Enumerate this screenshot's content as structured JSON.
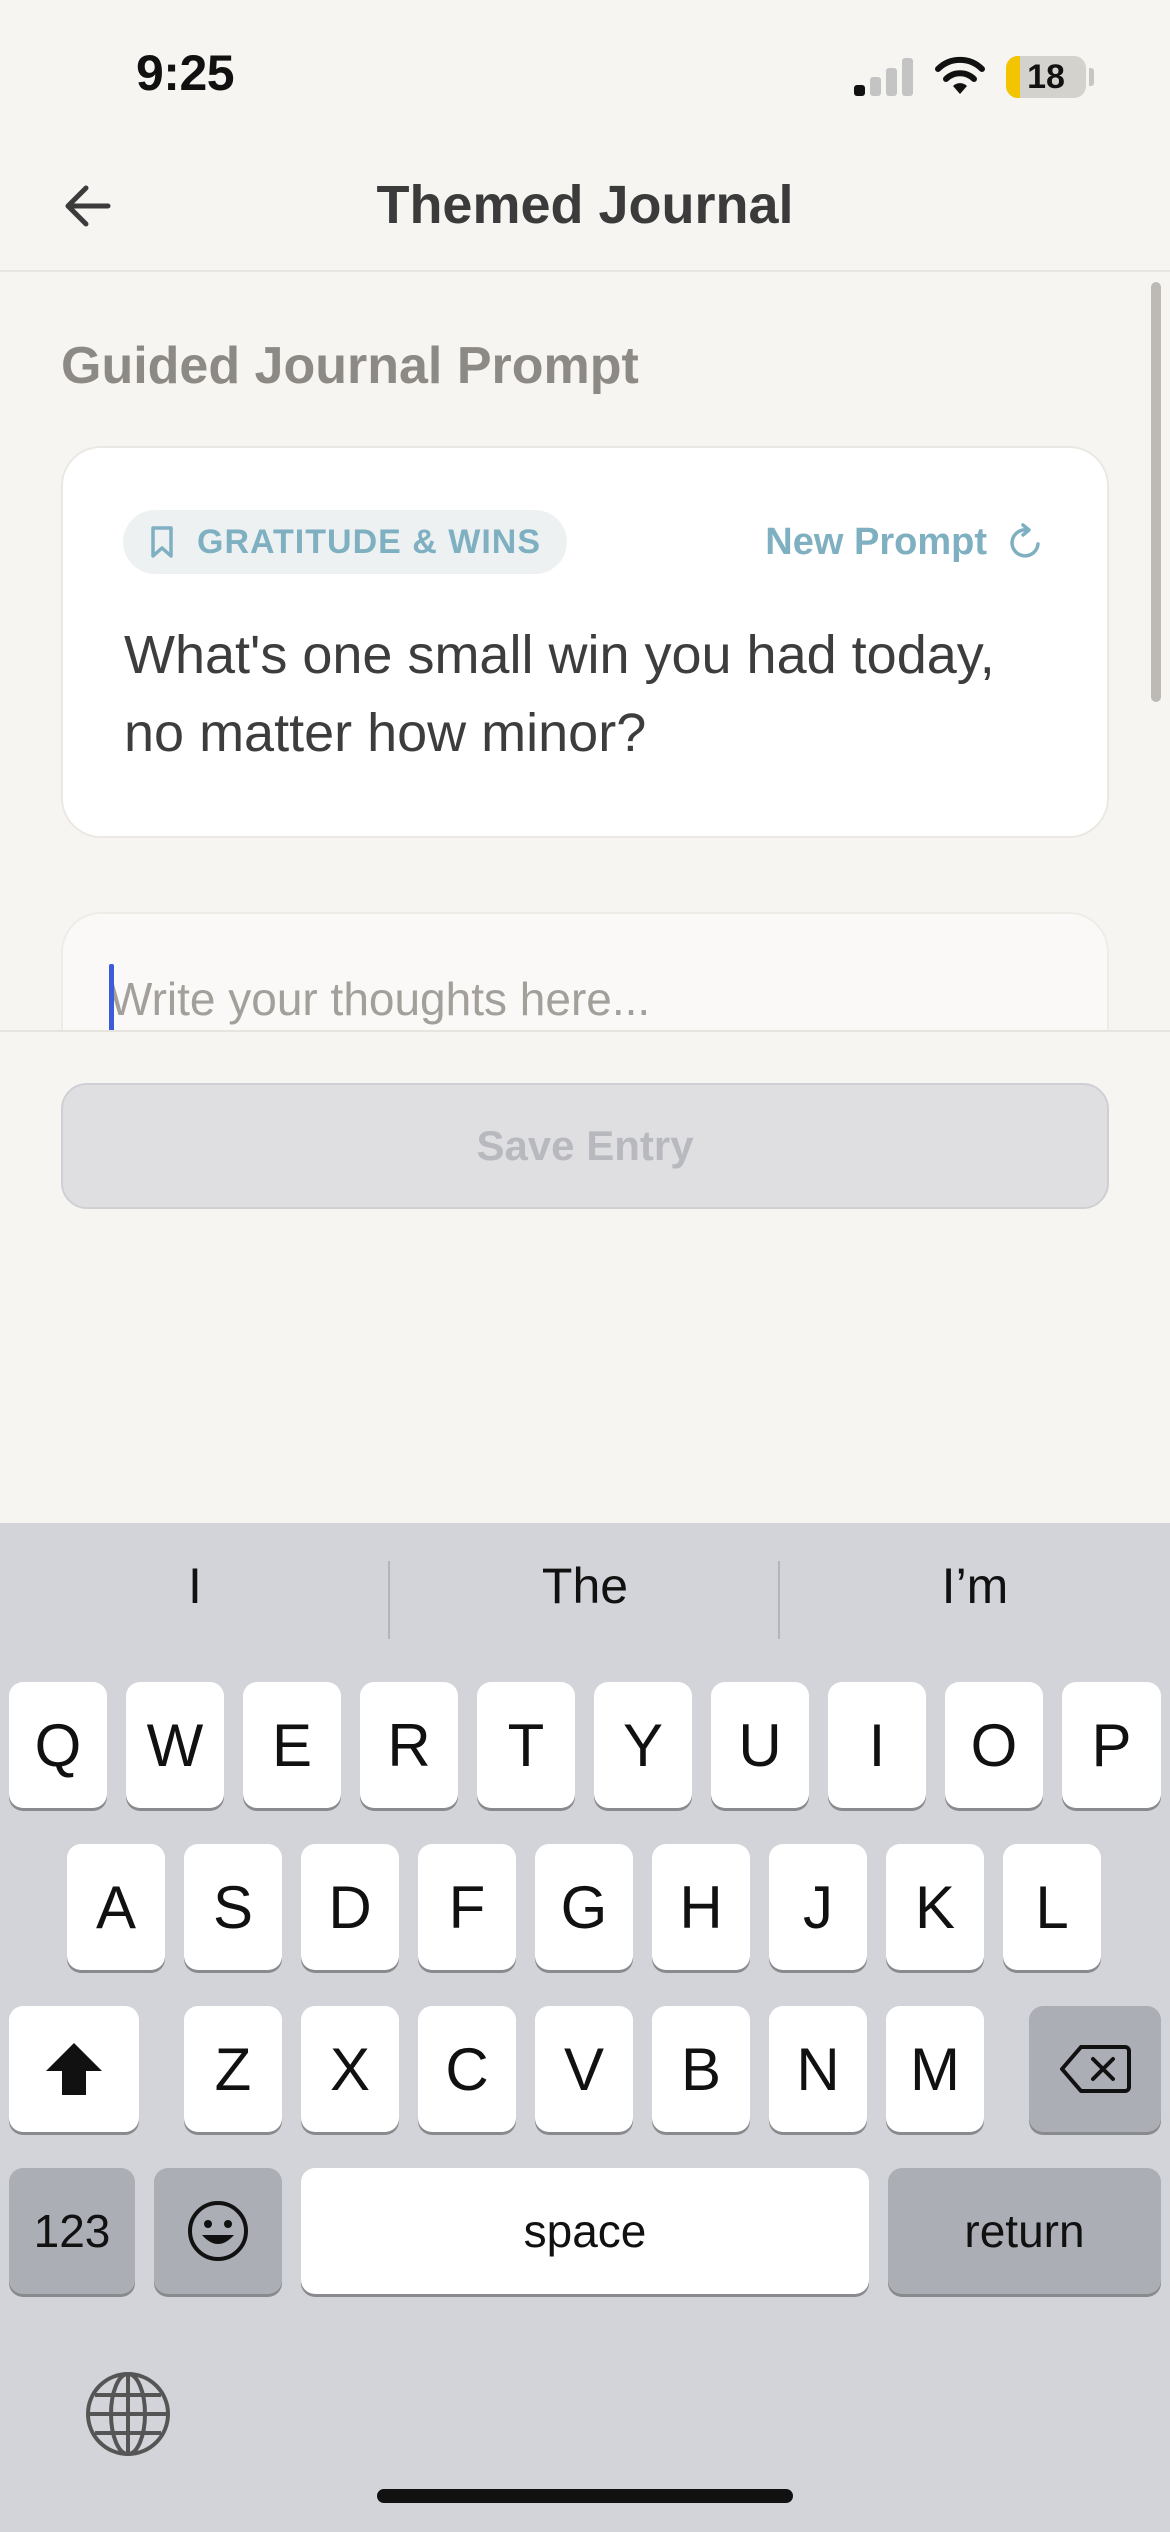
{
  "status_bar": {
    "time": "9:25",
    "battery": "18"
  },
  "nav": {
    "title": "Themed Journal"
  },
  "section": {
    "heading": "Guided Journal Prompt"
  },
  "prompt_card": {
    "category": "GRATITUDE & WINS",
    "new_prompt_label": "New Prompt",
    "prompt_text": "What's one small win you had today, no matter how minor?"
  },
  "entry": {
    "placeholder": "Write your thoughts here...",
    "value": ""
  },
  "save_button": {
    "label": "Save Entry"
  },
  "keyboard": {
    "suggestions": [
      "I",
      "The",
      "I’m"
    ],
    "row1": [
      "Q",
      "W",
      "E",
      "R",
      "T",
      "Y",
      "U",
      "I",
      "O",
      "P"
    ],
    "row2": [
      "A",
      "S",
      "D",
      "F",
      "G",
      "H",
      "J",
      "K",
      "L"
    ],
    "row3": [
      "Z",
      "X",
      "C",
      "V",
      "B",
      "N",
      "M"
    ],
    "numbers_label": "123",
    "space_label": "space",
    "return_label": "return"
  },
  "colors": {
    "accent": "#7eb0c2",
    "background": "#f7f5f2",
    "caret": "#3b5bdb",
    "battery_fill": "#f2c500"
  },
  "icons": {
    "back": "arrow-left-icon",
    "category": "bookmark-icon",
    "new_prompt": "refresh-icon",
    "shift": "shift-icon",
    "delete": "backspace-icon",
    "emoji": "emoji-icon",
    "globe": "globe-icon"
  }
}
